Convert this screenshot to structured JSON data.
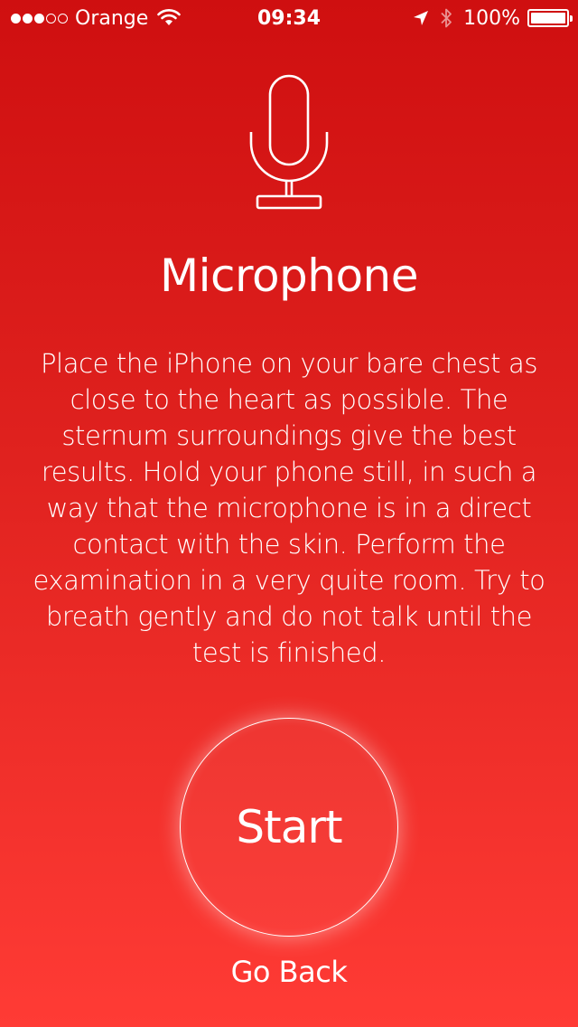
{
  "status_bar": {
    "carrier": "Orange",
    "time": "09:34",
    "battery": "100%",
    "signal_bars": 3,
    "signal_max": 5,
    "icons": [
      "signal-dots",
      "wifi-icon",
      "location-arrow-icon",
      "bluetooth-icon",
      "battery-icon"
    ]
  },
  "screen": {
    "icon": "microphone-icon",
    "title": "Microphone",
    "instructions": "Place the iPhone on your bare chest as close to the heart as possible. The sternum surroundings give the best results. Hold your phone still, in such a way that the microphone is in a direct contact with the skin. Perform the examination in a very quite room. Try to breath gently and do not talk until the test is finished.",
    "start_label": "Start",
    "back_label": "Go Back"
  },
  "colors": {
    "background_top": "#cf0f10",
    "background_bottom": "#ff3b35",
    "foreground": "#ffffff"
  }
}
